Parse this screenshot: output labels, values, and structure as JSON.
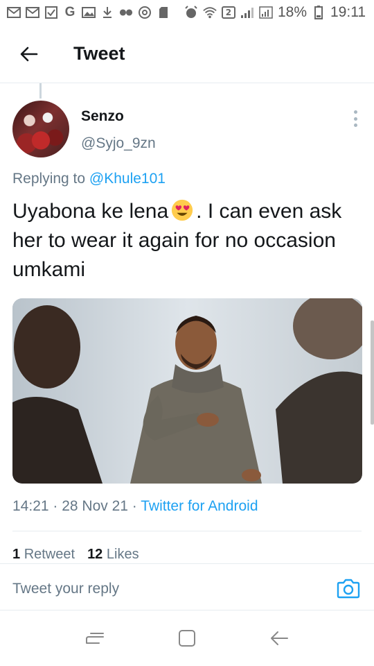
{
  "status_bar": {
    "left_icons": [
      "gmail-icon",
      "gmail-icon",
      "checkbox-icon",
      "google-icon",
      "image-icon",
      "download-icon",
      "voicemail-icon",
      "target-icon",
      "sd-card-icon"
    ],
    "right_icons": [
      "alarm-icon",
      "wifi-icon",
      "sim-icon",
      "signal-icon",
      "signal-icon",
      "battery-icon"
    ],
    "sim_label": "2",
    "battery": "18%",
    "time": "19:11"
  },
  "header": {
    "back_icon": "arrow-left-icon",
    "title": "Tweet"
  },
  "tweet": {
    "author_name": "Senzo",
    "author_handle": "@Syjo_9zn",
    "replying_prefix": "Replying to ",
    "replying_handle": "@Khule101",
    "text_before_emoji": "Uyabona ke lena",
    "emoji": "heart-eyes-emoji",
    "text_after_emoji": ". I can even ask her to wear it again for no occasion umkami",
    "media_alt": "Man in grey turtleneck sweater pointing at camera",
    "time": "14:21",
    "separator": " · ",
    "date": "28 Nov 21",
    "source": "Twitter for Android",
    "retweet_count": "1",
    "retweet_label": "Retweet",
    "like_count": "12",
    "like_label": "Likes"
  },
  "reply_bar": {
    "placeholder": "Tweet your reply",
    "camera_icon": "camera-icon"
  },
  "nav_bar": {
    "icons": [
      "recents-icon",
      "home-icon",
      "back-icon"
    ]
  },
  "colors": {
    "link": "#1da1f2",
    "secondary_text": "#657786",
    "primary_text": "#14171a",
    "divider": "#e6ecf0"
  }
}
